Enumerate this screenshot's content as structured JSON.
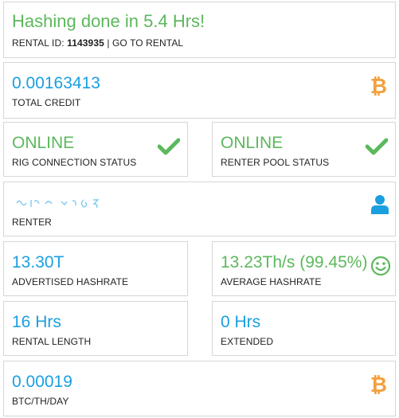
{
  "header": {
    "title": "Hashing done in 5.4 Hrs!",
    "rental_prefix": "RENTAL ID: ",
    "rental_id": "1143935",
    "separator": " | ",
    "goto_link": "GO TO RENTAL"
  },
  "total_credit": {
    "value": "0.00163413",
    "label": "TOTAL CREDIT",
    "icon": "bitcoin-icon"
  },
  "rig_status": {
    "value": "ONLINE",
    "label": "RIG CONNECTION STATUS",
    "icon": "checkmark-icon"
  },
  "pool_status": {
    "value": "ONLINE",
    "label": "RENTER POOL STATUS",
    "icon": "checkmark-icon"
  },
  "renter": {
    "label": "RENTER",
    "icon": "user-icon"
  },
  "advertised": {
    "value": "13.30T",
    "label": "ADVERTISED HASHRATE"
  },
  "average": {
    "value": "13.23Th/s (99.45%)",
    "label": "AVERAGE HASHRATE",
    "icon": "smiley-icon"
  },
  "rental_length": {
    "value": "16 Hrs",
    "label": "RENTAL LENGTH"
  },
  "extended": {
    "value": "0 Hrs",
    "label": "EXTENDED"
  },
  "btc_th_day": {
    "value": "0.00019",
    "label": "BTC/TH/DAY",
    "icon": "bitcoin-icon"
  },
  "colors": {
    "blue": "#1a9fe0",
    "green": "#5cb85c",
    "orange": "#f2a03d",
    "border": "#d6d6d6"
  }
}
